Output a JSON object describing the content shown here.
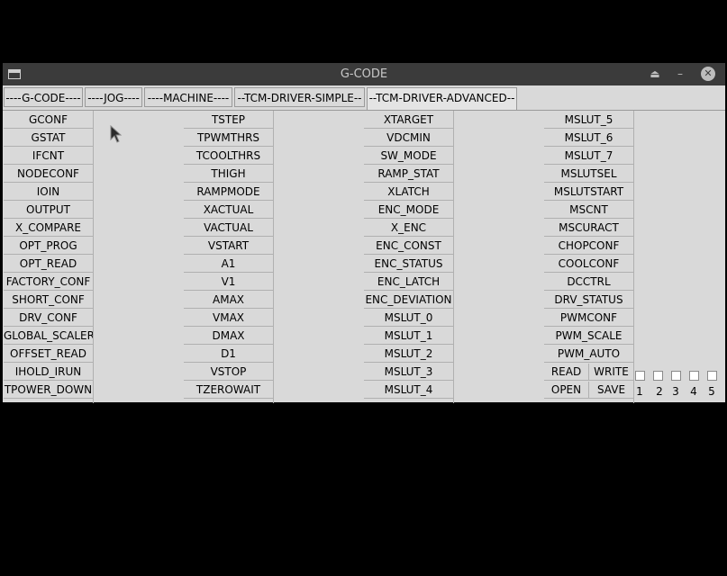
{
  "window": {
    "title": "G-CODE"
  },
  "icons": {
    "app": "window-icon",
    "shade": "eject-icon",
    "minimize": "minimize-icon",
    "close": "close-icon"
  },
  "tabs": [
    "----G-CODE----",
    "----JOG----",
    "----MACHINE----",
    "--TCM-DRIVER-SIMPLE--",
    "--TCM-DRIVER-ADVANCED--"
  ],
  "active_tab": "--TCM-DRIVER-ADVANCED--",
  "columns": [
    [
      "GCONF",
      "GSTAT",
      "IFCNT",
      "NODECONF",
      "IOIN",
      "OUTPUT",
      "X_COMPARE",
      "OPT_PROG",
      "OPT_READ",
      "FACTORY_CONF",
      "SHORT_CONF",
      "DRV_CONF",
      "GLOBAL_SCALER",
      "OFFSET_READ",
      "IHOLD_IRUN",
      "TPOWER_DOWN"
    ],
    [
      "TSTEP",
      "TPWMTHRS",
      "TCOOLTHRS",
      "THIGH",
      "RAMPMODE",
      "XACTUAL",
      "VACTUAL",
      "VSTART",
      "A1",
      "V1",
      "AMAX",
      "VMAX",
      "DMAX",
      "D1",
      "VSTOP",
      "TZEROWAIT"
    ],
    [
      "XTARGET",
      "VDCMIN",
      "SW_MODE",
      "RAMP_STAT",
      "XLATCH",
      "ENC_MODE",
      "X_ENC",
      "ENC_CONST",
      "ENC_STATUS",
      "ENC_LATCH",
      "ENC_DEVIATION",
      "MSLUT_0",
      "MSLUT_1",
      "MSLUT_2",
      "MSLUT_3",
      "MSLUT_4"
    ],
    [
      "MSLUT_5",
      "MSLUT_6",
      "MSLUT_7",
      "MSLUTSEL",
      "MSLUTSTART",
      "MSCNT",
      "MSCURACT",
      "CHOPCONF",
      "COOLCONF",
      "DCCTRL",
      "DRV_STATUS",
      "PWMCONF",
      "PWM_SCALE",
      "PWM_AUTO"
    ]
  ],
  "actions": {
    "read": "READ",
    "write": "WRITE",
    "open": "OPEN",
    "save": "SAVE"
  },
  "slots": [
    "1",
    "2",
    "3",
    "4",
    "5"
  ]
}
